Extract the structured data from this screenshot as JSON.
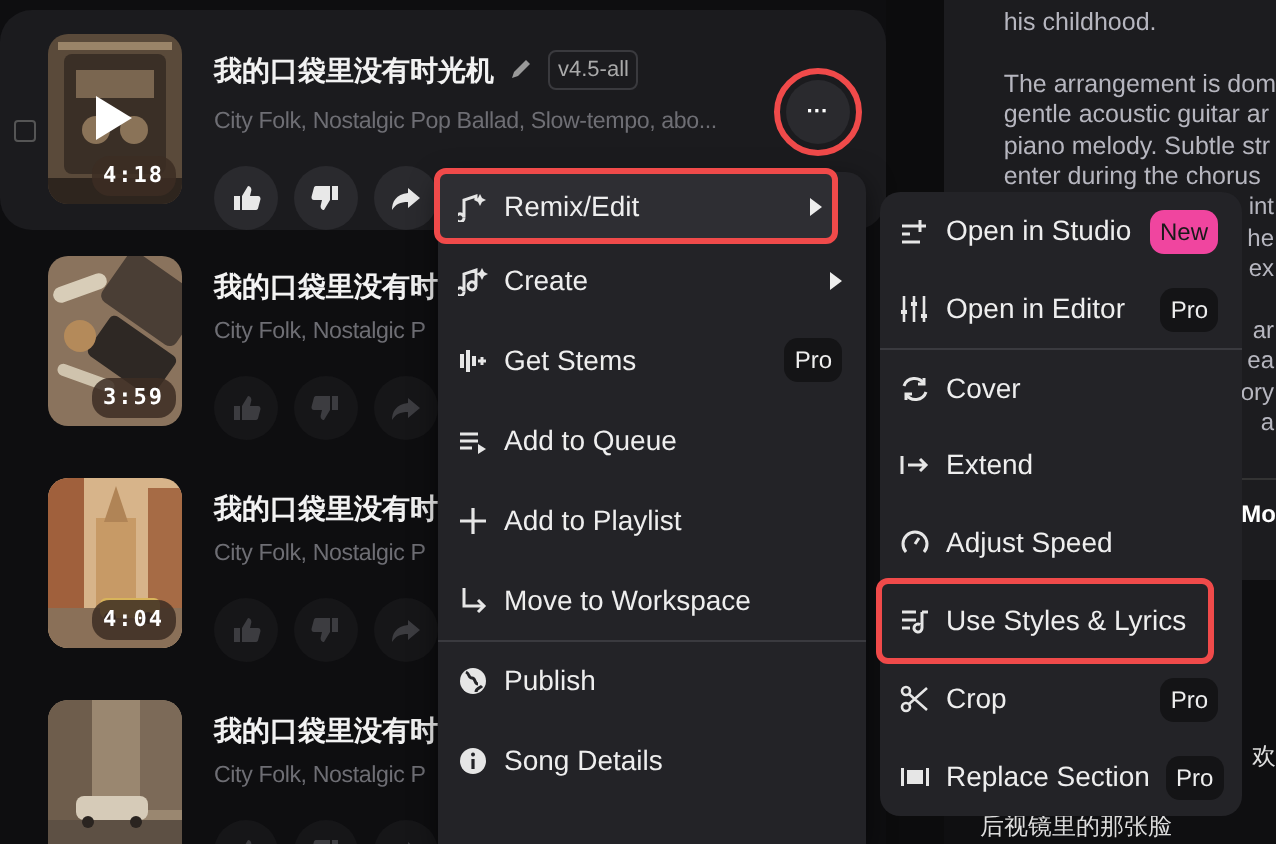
{
  "songs": [
    {
      "title": "我的口袋里没有时光机",
      "version": "v4.5-all",
      "tags": "City Folk, Nostalgic Pop Ballad, Slow-tempo, abo...",
      "duration": "4:18",
      "hovered": true,
      "checked": false
    },
    {
      "title": "我的口袋里没有时",
      "tags": "City Folk, Nostalgic P",
      "duration": "3:59",
      "hovered": false
    },
    {
      "title": "我的口袋里没有时",
      "tags": "City Folk, Nostalgic P",
      "duration": "4:04",
      "hovered": false
    },
    {
      "title": "我的口袋里没有时",
      "tags": "City Folk, Nostalgic P",
      "hovered": false
    }
  ],
  "more_button": {
    "label": "···",
    "highlighted": true
  },
  "menu": [
    {
      "label": "Remix/Edit",
      "submenu": true,
      "selected": true,
      "highlighted": true,
      "divider_before": false
    },
    {
      "label": "Create",
      "submenu": true,
      "selected": false,
      "highlighted": false,
      "divider_before": false
    },
    {
      "label": "Get Stems",
      "badge": {
        "text": "Pro",
        "color": "#141416"
      },
      "submenu": false,
      "selected": false,
      "highlighted": false,
      "divider_before": false
    },
    {
      "label": "Add to Queue",
      "submenu": false,
      "selected": false,
      "highlighted": false,
      "divider_before": false
    },
    {
      "label": "Add to Playlist",
      "submenu": false,
      "selected": false,
      "highlighted": false,
      "divider_before": false
    },
    {
      "label": "Move to Workspace",
      "submenu": false,
      "selected": false,
      "highlighted": false,
      "divider_before": false
    },
    {
      "label": "Publish",
      "submenu": false,
      "selected": false,
      "highlighted": false,
      "divider_before": true
    },
    {
      "label": "Song Details",
      "submenu": false,
      "selected": false,
      "highlighted": false,
      "divider_before": false
    }
  ],
  "submenu": [
    {
      "label": "Open in Studio",
      "badge": {
        "text": "New",
        "color": "#f0459f"
      },
      "highlighted": false,
      "divider_before": false
    },
    {
      "label": "Open in Editor",
      "badge": {
        "text": "Pro",
        "color": "#141416"
      },
      "highlighted": false,
      "divider_before": false
    },
    {
      "label": "Cover",
      "highlighted": false,
      "divider_before": true
    },
    {
      "label": "Extend",
      "highlighted": false,
      "divider_before": false
    },
    {
      "label": "Adjust Speed",
      "highlighted": false,
      "divider_before": false
    },
    {
      "label": "Use Styles & Lyrics",
      "highlighted": true,
      "divider_before": false
    },
    {
      "label": "Crop",
      "badge": {
        "text": "Pro",
        "color": "#141416"
      },
      "highlighted": false,
      "divider_before": false
    },
    {
      "label": "Replace Section",
      "badge": {
        "text": "Pro",
        "color": "#141416"
      },
      "highlighted": false,
      "divider_before": false
    }
  ],
  "description": {
    "paragraphs": [
      [
        {
          "text": "his childhood."
        }
      ],
      [
        {
          "text": "The arrangement is dom"
        },
        {
          "text": "gentle acoustic guitar ar"
        },
        {
          "text": "piano melody. Subtle str"
        },
        {
          "text": "enter during the chorus"
        },
        {
          "fragment": "int"
        },
        {
          "fragment": "he"
        },
        {
          "fragment": "ex"
        }
      ],
      [
        {
          "fragment": "ar"
        },
        {
          "fragment": "ea"
        },
        {
          "fragment": "ory"
        },
        {
          "fragment": "a"
        }
      ]
    ],
    "more_label": "Mo"
  },
  "lyrics": [
    {
      "fragment": "欢"
    },
    {
      "text": "后视镜里的那张脸"
    }
  ]
}
